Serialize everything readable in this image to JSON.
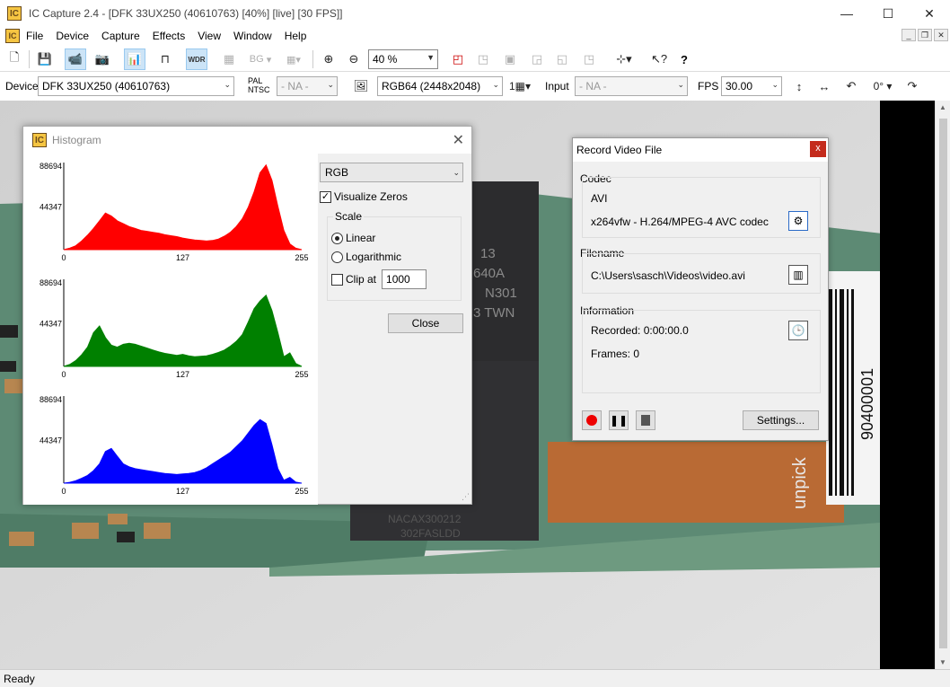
{
  "window": {
    "title": "IC Capture 2.4 - [DFK 33UX250 (40610763) [40%] [live] [30 FPS]]",
    "minimize": "—",
    "maximize": "☐",
    "close": "✕"
  },
  "menu": {
    "items": [
      "File",
      "Device",
      "Capture",
      "Effects",
      "View",
      "Window",
      "Help"
    ]
  },
  "toolbar": {
    "zoom_value": "40 %",
    "bg_label": "BG",
    "wdr_label": "WDR"
  },
  "devicebar": {
    "device_label": "Device",
    "device_value": "DFK 33UX250 (40610763)",
    "palntsc_label": "PAL NTSC",
    "palntsc_value": "- NA -",
    "format_value": "RGB64 (2448x2048)",
    "binning_value": "1",
    "input_label": "Input",
    "input_value": "- NA -",
    "fps_label": "FPS",
    "fps_value": "30.00",
    "rotation_value": "0°"
  },
  "status": {
    "text": "Ready"
  },
  "histogram": {
    "title": "Histogram",
    "channel_value": "RGB",
    "visualize_zeros_label": "Visualize Zeros",
    "visualize_zeros_checked": true,
    "scale_label": "Scale",
    "linear_label": "Linear",
    "logarithmic_label": "Logarithmic",
    "selected_scale": "linear",
    "clip_label": "Clip at",
    "clip_checked": false,
    "clip_value": "1000",
    "close_label": "Close",
    "plots": [
      {
        "color": "#ff0000",
        "ymax_label": "88694",
        "ymid_label": "44347",
        "x_labels": [
          "0",
          "127",
          "255"
        ],
        "values": [
          0,
          1500,
          4000,
          9000,
          15000,
          22000,
          30000,
          38000,
          35000,
          30000,
          27000,
          24000,
          22000,
          20000,
          19000,
          18000,
          17000,
          15500,
          14500,
          13500,
          12000,
          11000,
          10000,
          9500,
          9000,
          9500,
          11000,
          14000,
          18000,
          24000,
          32000,
          44000,
          60000,
          80000,
          88000,
          72000,
          45000,
          20000,
          6000,
          1500,
          0
        ]
      },
      {
        "color": "#008000",
        "ymax_label": "88694",
        "ymid_label": "44347",
        "x_labels": [
          "0",
          "127",
          "255"
        ],
        "values": [
          0,
          2000,
          6000,
          12000,
          20000,
          35000,
          42000,
          30000,
          22000,
          20000,
          23000,
          24000,
          23000,
          21000,
          19000,
          17000,
          15000,
          13500,
          12500,
          11500,
          12500,
          11000,
          10000,
          10500,
          11000,
          12500,
          14500,
          17000,
          21000,
          26000,
          33000,
          46000,
          60000,
          68000,
          74000,
          58000,
          35000,
          10000,
          14000,
          3000,
          0
        ]
      },
      {
        "color": "#0000ff",
        "ymax_label": "88694",
        "ymid_label": "44347",
        "x_labels": [
          "0",
          "127",
          "255"
        ],
        "values": [
          0,
          800,
          2500,
          5000,
          8000,
          13000,
          20000,
          33000,
          36000,
          28000,
          20000,
          17000,
          15000,
          14000,
          13000,
          12000,
          11000,
          10000,
          9500,
          9000,
          9500,
          10000,
          11000,
          13000,
          16000,
          20000,
          24000,
          28000,
          32000,
          38000,
          44000,
          52000,
          60000,
          66000,
          62000,
          40000,
          15000,
          3000,
          6000,
          1000,
          0
        ]
      }
    ]
  },
  "record": {
    "title": "Record Video File",
    "close": "x",
    "codec_group": "Codec",
    "codec_container": "AVI",
    "codec_name": "x264vfw - H.264/MPEG-4 AVC codec",
    "filename_group": "Filename",
    "filename_value": "C:\\Users\\sasch\\Videos\\video.avi",
    "info_group": "Information",
    "recorded_text": "Recorded: 0:00:00.0",
    "frames_text": "Frames: 0",
    "settings_label": "Settings..."
  },
  "image": {
    "chip_lines": [
      "13",
      "640A",
      "N301",
      "3 TWN"
    ],
    "chip2_lines": [
      "NACAX300212",
      "302FASLDD"
    ],
    "barcode_text": "90400001",
    "unpick_text": "unpick"
  }
}
